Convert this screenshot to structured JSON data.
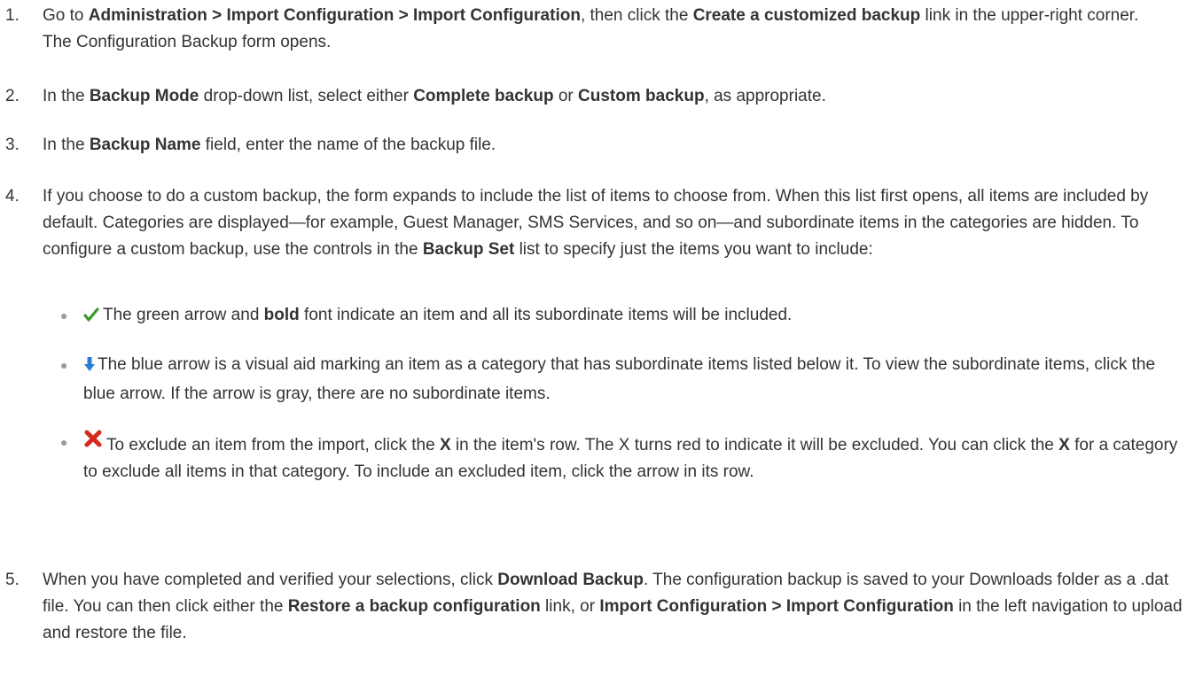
{
  "steps": [
    {
      "num": "1.",
      "parts": [
        {
          "t": "Go to "
        },
        {
          "t": "Administration > Import Configuration > Import Configuration",
          "b": true
        },
        {
          "t": ", then click the "
        },
        {
          "t": "Create a customized backup",
          "b": true
        },
        {
          "t": " link in the upper-right corner. The Configuration Backup form opens."
        }
      ]
    },
    {
      "num": "2.",
      "parts": [
        {
          "t": "In the "
        },
        {
          "t": "Backup Mode",
          "b": true
        },
        {
          "t": " drop-down list, select either "
        },
        {
          "t": "Complete backup",
          "b": true
        },
        {
          "t": " or "
        },
        {
          "t": "Custom backup",
          "b": true
        },
        {
          "t": ", as appropriate."
        }
      ]
    },
    {
      "num": "3.",
      "parts": [
        {
          "t": "In the "
        },
        {
          "t": "Backup Name",
          "b": true
        },
        {
          "t": " field, enter the name of the backup file."
        }
      ]
    },
    {
      "num": "4.",
      "parts": [
        {
          "t": "If you choose to do a custom backup, the form expands to include the list of items to choose from. When this list first opens, all items are included by default. Categories are displayed—for example, Guest Manager, SMS Services, and so on—and subordinate items in the categories are hidden. To configure a custom backup, use the controls in the "
        },
        {
          "t": "Backup Set",
          "b": true
        },
        {
          "t": " list to specify just the items you want to include:"
        }
      ]
    },
    {
      "num": "5.",
      "parts": [
        {
          "t": "When you have completed and verified your selections, click "
        },
        {
          "t": "Download Backup",
          "b": true
        },
        {
          "t": ". The configuration backup is saved to your Downloads folder as a .dat file. You can then click either the "
        },
        {
          "t": "Restore a backup configuration",
          "b": true
        },
        {
          "t": " link, or "
        },
        {
          "t": "Import Configuration > Import Configuration",
          "b": true
        },
        {
          "t": " in the left navigation to upload and restore the file."
        }
      ]
    }
  ],
  "bullets": [
    {
      "icon": "green-checkmark-icon",
      "color": "#3a9a2a",
      "parts": [
        {
          "t": "The green arrow and "
        },
        {
          "t": "bold",
          "b": true
        },
        {
          "t": " font indicate an item and all its subordinate items will be included."
        }
      ]
    },
    {
      "icon": "blue-down-arrow-icon",
      "color": "#2a7fd4",
      "parts": [
        {
          "t": "The blue arrow is a visual aid marking an item as a category that has subordinate items listed below it. To view the subordinate items, click the blue arrow. If the arrow is gray, there are no subordinate items."
        }
      ]
    },
    {
      "icon": "red-x-icon",
      "color": "#d62a1e",
      "parts": [
        {
          "t": "To exclude an item from the import, click the "
        },
        {
          "t": "X",
          "b": true
        },
        {
          "t": " in the item's row. The X turns red to indicate it will be excluded. You can click the "
        },
        {
          "t": "X",
          "b": true
        },
        {
          "t": " for a category to exclude all items in that category. To include an excluded item, click the arrow in its row."
        }
      ]
    }
  ]
}
